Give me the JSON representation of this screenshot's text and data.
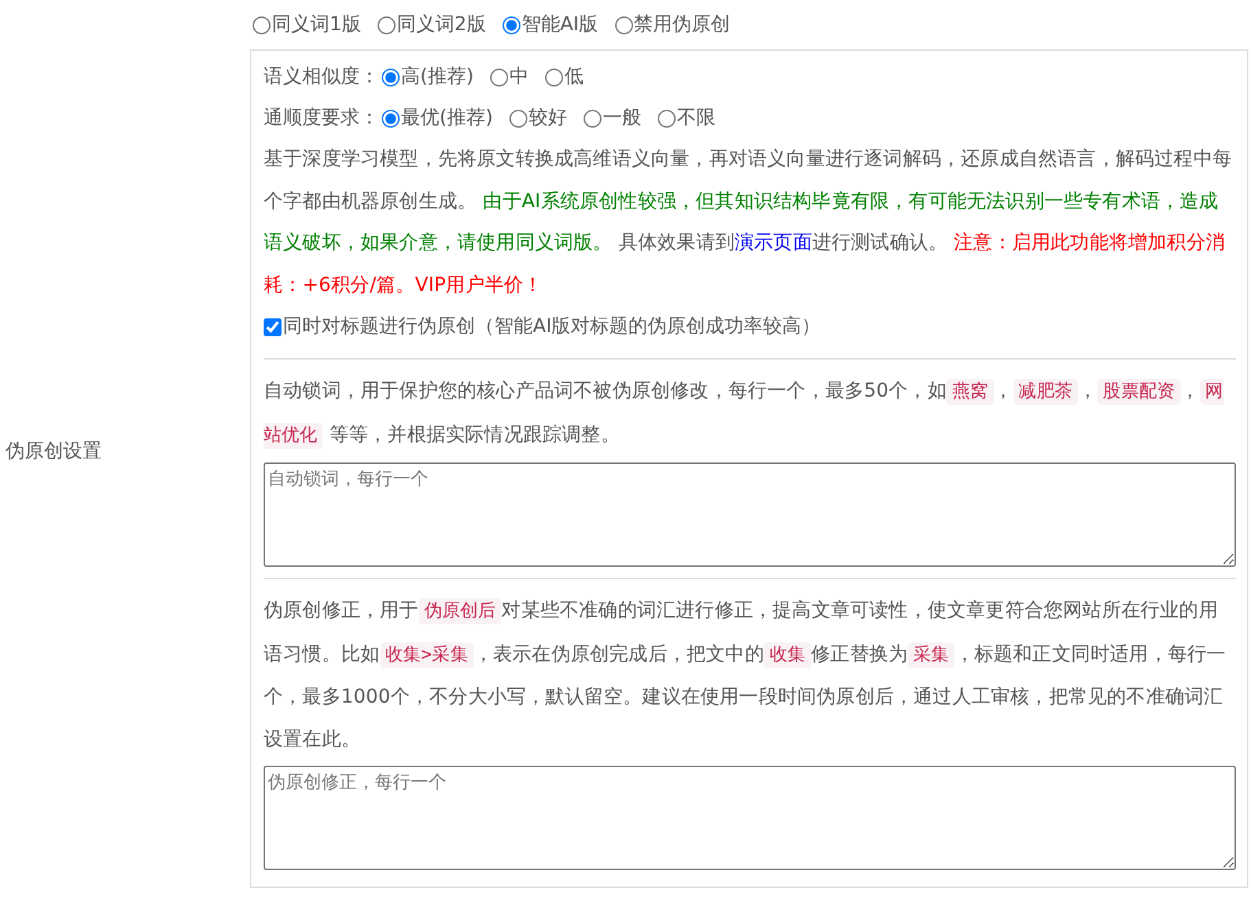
{
  "section_label": "伪原创设置",
  "modes": [
    {
      "label": "同义词1版",
      "selected": false
    },
    {
      "label": "同义词2版",
      "selected": false
    },
    {
      "label": "智能AI版",
      "selected": true
    },
    {
      "label": "禁用伪原创",
      "selected": false
    }
  ],
  "similarity": {
    "label": "语义相似度：",
    "options": [
      {
        "label": "高(推荐)",
        "selected": true
      },
      {
        "label": "中",
        "selected": false
      },
      {
        "label": "低",
        "selected": false
      }
    ]
  },
  "fluency": {
    "label": "通顺度要求：",
    "options": [
      {
        "label": "最优(推荐)",
        "selected": true
      },
      {
        "label": "较好",
        "selected": false
      },
      {
        "label": "一般",
        "selected": false
      },
      {
        "label": "不限",
        "selected": false
      }
    ]
  },
  "description": [
    {
      "kind": "text",
      "text": "基于深度学习模型，先将原文转换成高维语义向量，再对语义向量进行逐词解码，还原成自然语言，解码过程中每个字都由机器原创生成。 "
    },
    {
      "kind": "success",
      "text": "由于AI系统原创性较强，但其知识结构毕竟有限，有可能无法识别一些专有术语，造成语义破坏，如果介意，请使用同义词版。"
    },
    {
      "kind": "text",
      "text": " 具体效果请到"
    },
    {
      "kind": "link",
      "text": "演示页面"
    },
    {
      "kind": "text",
      "text": "进行测试确认。 "
    },
    {
      "kind": "warning",
      "text": "注意：启用此功能将增加积分消耗：+6积分/篇。VIP用户半价！"
    }
  ],
  "title_option": {
    "label": "同时对标题进行伪原创（智能AI版对标题的伪原创成功率较高）",
    "checked": true
  },
  "lock_words": {
    "description": [
      {
        "kind": "text",
        "text": "自动锁词，用于保护您的核心产品词不被伪原创修改，每行一个，最多50个，如"
      },
      {
        "kind": "tag",
        "text": "燕窝"
      },
      {
        "kind": "text",
        "text": "，"
      },
      {
        "kind": "tag",
        "text": "减肥茶"
      },
      {
        "kind": "text",
        "text": "，"
      },
      {
        "kind": "tag",
        "text": "股票配资"
      },
      {
        "kind": "text",
        "text": "，"
      },
      {
        "kind": "tag",
        "text": "网站优化"
      },
      {
        "kind": "text",
        "text": " 等等，并根据实际情况跟踪调整。"
      }
    ],
    "placeholder": "自动锁词，每行一个"
  },
  "corrections": {
    "description": [
      {
        "kind": "text",
        "text": "伪原创修正，用于"
      },
      {
        "kind": "tag",
        "text": "伪原创后"
      },
      {
        "kind": "text",
        "text": "对某些不准确的词汇进行修正，提高文章可读性，使文章更符合您网站所在行业的用语习惯。比如"
      },
      {
        "kind": "tag",
        "text": "收集>采集"
      },
      {
        "kind": "text",
        "text": "，表示在伪原创完成后，把文中的"
      },
      {
        "kind": "tag",
        "text": "收集"
      },
      {
        "kind": "text",
        "text": "修正替换为"
      },
      {
        "kind": "tag",
        "text": "采集"
      },
      {
        "kind": "text",
        "text": "，标题和正文同时适用，每行一个，最多1000个，不分大小写，默认留空。建议在使用一段时间伪原创后，通过人工审核，把常见的不准确词汇设置在此。"
      }
    ],
    "placeholder": "伪原创修正，每行一个"
  }
}
